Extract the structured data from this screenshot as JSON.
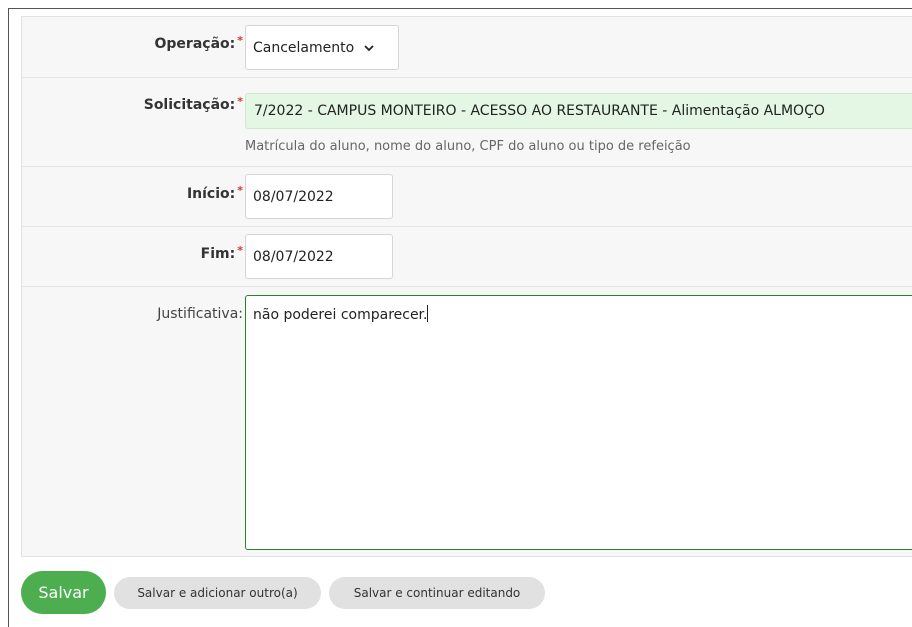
{
  "form": {
    "operacao": {
      "label": "Operação:",
      "required_mark": "*",
      "value": "Cancelamento"
    },
    "solicitacao": {
      "label": "Solicitação:",
      "required_mark": "*",
      "value": "7/2022 - CAMPUS MONTEIRO - ACESSO AO RESTAURANTE - Alimentação ALMOÇO",
      "help": "Matrícula do aluno, nome do aluno, CPF do aluno ou tipo de refeição"
    },
    "inicio": {
      "label": "Início:",
      "required_mark": "*",
      "value": "08/07/2022"
    },
    "fim": {
      "label": "Fim:",
      "required_mark": "*",
      "value": "08/07/2022"
    },
    "justificativa": {
      "label": "Justificativa:",
      "value": "não poderei comparecer."
    }
  },
  "actions": {
    "save": "Salvar",
    "save_add": "Salvar e adicionar outro(a)",
    "save_continue": "Salvar e continuar editando"
  },
  "colors": {
    "primary": "#4cae4f",
    "required": "#d9342b",
    "solicitacao_bg": "#e4f6e4",
    "focus_border": "#2e7d32"
  },
  "icons": {
    "select_arrow": "chevron-down-icon"
  }
}
